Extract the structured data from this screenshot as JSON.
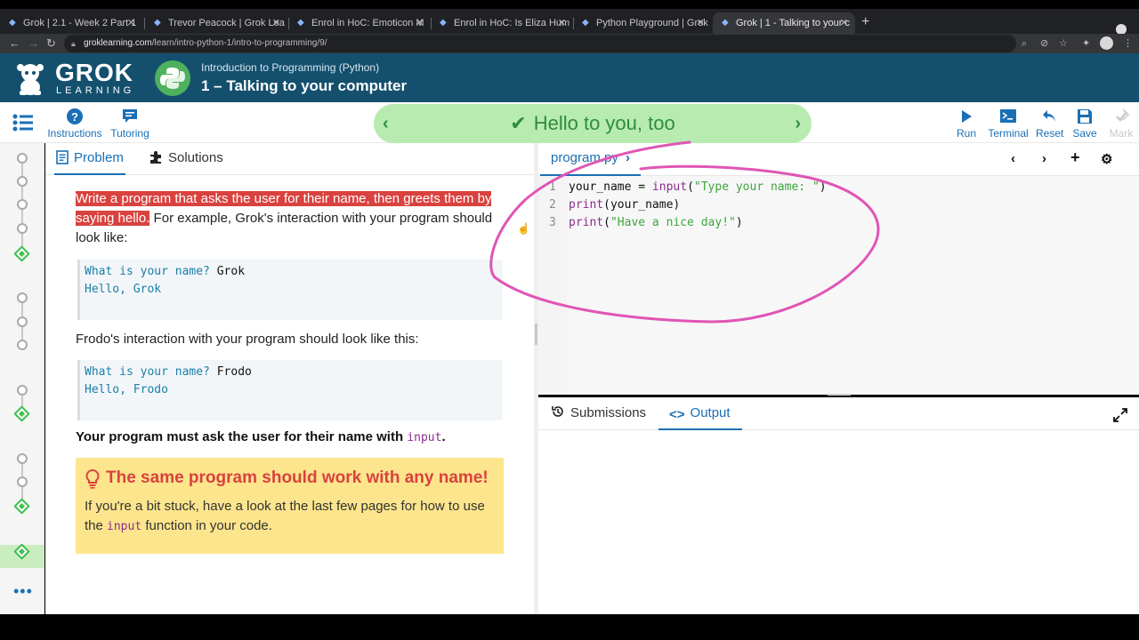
{
  "browser": {
    "tabs": [
      {
        "label": "Grok | 2.1 - Week 2 Part 1",
        "active": false
      },
      {
        "label": "Trevor Peacock | Grok Lea",
        "active": false
      },
      {
        "label": "Enrol in HoC: Emoticon M",
        "active": false
      },
      {
        "label": "Enrol in HoC: Is Eliza Hum",
        "active": false
      },
      {
        "label": "Python Playground | Grok",
        "active": false
      },
      {
        "label": "Grok | 1 - Talking to your c",
        "active": true
      }
    ],
    "url_host": "groklearning.com",
    "url_path": "/learn/intro-python-1/intro-to-programming/9/"
  },
  "header": {
    "logo_main": "GROK",
    "logo_sub": "LEARNING",
    "course": "Introduction to Programming (Python)",
    "lesson": "1 – Talking to your computer"
  },
  "toolbar": {
    "instructions_label": "Instructions",
    "tutoring_label": "Tutoring",
    "banner_text": "Hello to you, too",
    "run_label": "Run",
    "terminal_label": "Terminal",
    "reset_label": "Reset",
    "save_label": "Save",
    "mark_label": "Mark"
  },
  "problem": {
    "tab_problem": "Problem",
    "tab_solutions": "Solutions",
    "intro_highlight": "Write a program that asks the user for their name, then greets them by saying hello.",
    "intro_rest": " For example, Grok's interaction with your program should look like:",
    "example1": {
      "prompt": "What is your name? ",
      "answer": "Grok",
      "reply": "Hello, Grok"
    },
    "frodo_text": "Frodo's interaction with your program should look like this:",
    "example2": {
      "prompt": "What is your name? ",
      "answer": "Frodo",
      "reply": "Hello, Frodo"
    },
    "must_text": "Your program must ask the user for their name with ",
    "must_code": "input",
    "must_end": ".",
    "hint_title": "The same program should work with any name!",
    "hint_text_1": "If you're a bit stuck, have a look at the last few pages for how to use the ",
    "hint_code": "input",
    "hint_text_2": " function in your code."
  },
  "editor": {
    "filename": "program.py",
    "lines": [
      {
        "num": "1",
        "a": "your_name = ",
        "kw": "input",
        "b": "(",
        "str": "\"Type your name: \"",
        "c": ")"
      },
      {
        "num": "2",
        "kw": "print",
        "b": "(your_name)"
      },
      {
        "num": "3",
        "kw": "print",
        "b": "(",
        "str": "\"Have a nice day!\"",
        "c": ")"
      }
    ]
  },
  "output": {
    "tab_submissions": "Submissions",
    "tab_output": "Output"
  },
  "colors": {
    "header_bg": "#14506e",
    "accent": "#1a6fb5",
    "success": "#2e8d3e",
    "highlight_red": "#d9423f",
    "annotation": "#e055b5"
  }
}
